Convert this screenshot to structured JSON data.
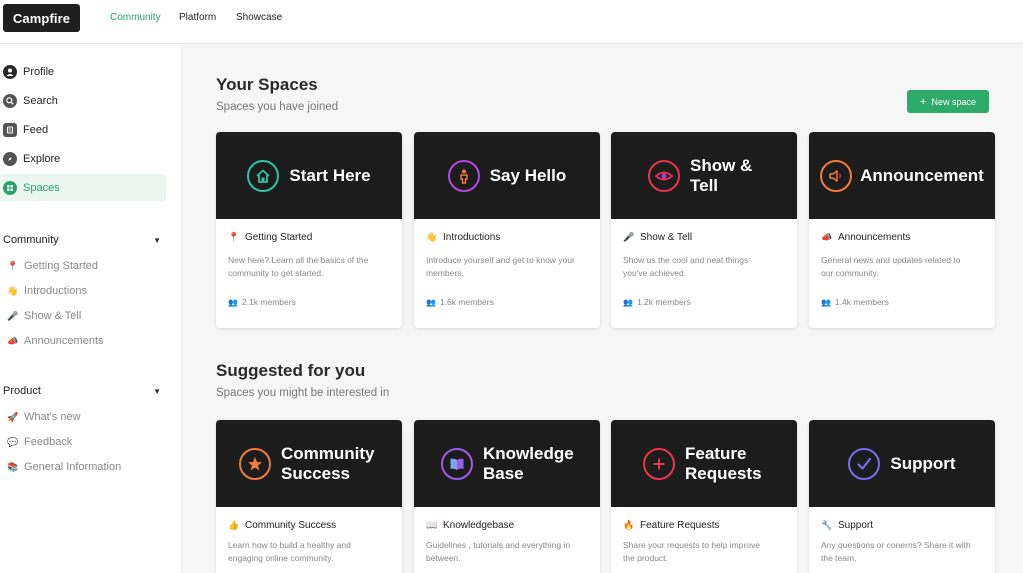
{
  "app": {
    "logo": "Campfire"
  },
  "topnav": [
    {
      "label": "Community",
      "active": true
    },
    {
      "label": "Platform",
      "active": false
    },
    {
      "label": "Showcase",
      "active": false
    }
  ],
  "sidebar": {
    "items": [
      {
        "label": "Profile",
        "icon": "user-icon"
      },
      {
        "label": "Search",
        "icon": "search-icon"
      },
      {
        "label": "Feed",
        "icon": "feed-icon"
      },
      {
        "label": "Explore",
        "icon": "compass-icon"
      },
      {
        "label": "Spaces",
        "icon": "grid-icon",
        "active": true
      }
    ],
    "community": {
      "title": "Community",
      "items": [
        {
          "emoji": "📍",
          "label": "Getting Started"
        },
        {
          "emoji": "👋",
          "label": "Introductions"
        },
        {
          "emoji": "🎤",
          "label": "Show & Tell"
        },
        {
          "emoji": "📣",
          "label": "Announcements"
        }
      ]
    },
    "product": {
      "title": "Product",
      "items": [
        {
          "emoji": "🚀",
          "label": "What's new"
        },
        {
          "emoji": "💬",
          "label": "Feedback"
        },
        {
          "emoji": "📚",
          "label": "General Information"
        }
      ]
    }
  },
  "your_spaces": {
    "title": "Your Spaces",
    "subtitle": "Spaces you have joined",
    "new_button": "New space",
    "cards": [
      {
        "banner": "Start Here",
        "icon": "home-icon",
        "color": "#2ec4a6",
        "emoji": "📍",
        "title": "Getting Started",
        "desc": "New here? Learn all the basics of the community to get started.",
        "members": "2.1k members"
      },
      {
        "banner": "Say Hello",
        "icon": "person-icon",
        "color": "#b04ae0",
        "emoji": "👋",
        "title": "Introductions",
        "desc": "Introduce yourself and get to know your members.",
        "members": "1.6k members"
      },
      {
        "banner": "Show & Tell",
        "icon": "eye-icon",
        "color": "#e8344e",
        "emoji": "🎤",
        "title": "Show & Tell",
        "desc": "Show us the cool and neat things you've achieved.",
        "members": "1.2k members"
      },
      {
        "banner": "Announcement",
        "icon": "megaphone-icon",
        "color": "#f27a3c",
        "emoji": "📣",
        "title": "Announcements",
        "desc": "General news and updates related to our community.",
        "members": "1.4k members"
      }
    ]
  },
  "suggested": {
    "title": "Suggested for you",
    "subtitle": "Spaces you might be interested in",
    "cards": [
      {
        "banner": "Community Success",
        "icon": "star-icon",
        "color": "#f27a3c",
        "emoji": "👍",
        "title": "Community Success",
        "desc": "Learn how to build a healthy and engaging online community."
      },
      {
        "banner": "Knowledge Base",
        "icon": "book-icon",
        "color": "#9a5de8",
        "emoji": "📖",
        "title": "Knowledgebase",
        "desc": "Guidelines , tutorials and everything in between."
      },
      {
        "banner": "Feature Requests",
        "icon": "plus-circle-icon",
        "color": "#e8344e",
        "emoji": "🔥",
        "title": "Feature Requests",
        "desc": "Share your requests to help improve the product."
      },
      {
        "banner": "Support",
        "icon": "check-circle-icon",
        "color": "#7a6cf0",
        "emoji": "🔧",
        "title": "Support",
        "desc": "Any questions or conerns? Share it with the team."
      }
    ]
  }
}
